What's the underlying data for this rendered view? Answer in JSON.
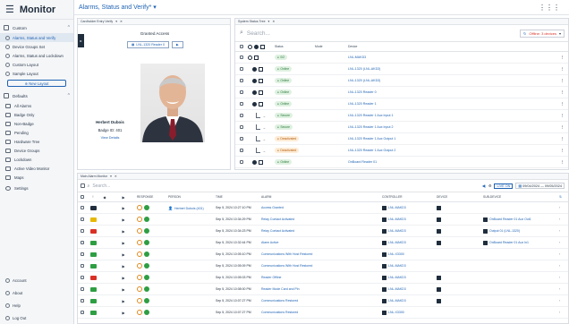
{
  "app": {
    "brand": "Monitor",
    "page_title": "Alarms, Status and Verify*"
  },
  "sidebar": {
    "custom_label": "Custom",
    "custom_items": [
      {
        "label": "Alarms, Status and Verify",
        "active": true
      },
      {
        "label": "Device Groups Set",
        "active": false
      },
      {
        "label": "Alarms, Status and Lockdown",
        "active": false
      },
      {
        "label": "Custom Layout",
        "active": false
      },
      {
        "label": "Sample Layout",
        "active": false
      }
    ],
    "new_layout_label": "New Layout",
    "defaults_label": "Defaults",
    "default_items": [
      {
        "label": "All Alarms"
      },
      {
        "label": "Badge Only"
      },
      {
        "label": "Non-Badge"
      },
      {
        "label": "Pending"
      },
      {
        "label": "Hardware Tree"
      },
      {
        "label": "Device Groups"
      },
      {
        "label": "Lockdown"
      },
      {
        "label": "Active Video Monitor"
      },
      {
        "label": "Maps"
      }
    ],
    "settings_label": "Settings",
    "bottom_items": [
      {
        "label": "Account"
      },
      {
        "label": "About"
      },
      {
        "label": "Help"
      },
      {
        "label": "Log Out"
      }
    ]
  },
  "card_panel": {
    "tab_label": "Cardholder Entry Verify",
    "granted": "Granted Access",
    "reader": "LNL-1320 Reader 0",
    "name": "Herbert Dubois",
    "badge": "Badge ID: 401",
    "view_details": "View Details"
  },
  "status_panel": {
    "tab_label": "System Status Tree",
    "search_placeholder": "Search...",
    "offline_label": "Offline: 3 devices",
    "headers": {
      "status": "Status",
      "mode": "Mode",
      "device": "Device"
    },
    "rows": [
      {
        "status": "0/2",
        "status_type": "online",
        "device": "LNL-MAKD3",
        "node": "root"
      },
      {
        "status": "Online",
        "status_type": "online",
        "device": "LNL-1320 (LNL-AKD3)",
        "node": "child"
      },
      {
        "status": "Online",
        "status_type": "online",
        "device": "LNL-1320 (LNL-AKD3)",
        "node": "child"
      },
      {
        "status": "Online",
        "status_type": "online",
        "device": "LNL-1320 Reader 0",
        "node": "child"
      },
      {
        "status": "Online",
        "status_type": "online",
        "device": "LNL-1320 Reader 1",
        "node": "child"
      },
      {
        "status": "Secure",
        "status_type": "secure",
        "device": "LNL-1320 Reader 1 Aux Input 1",
        "node": "leaf"
      },
      {
        "status": "Secure",
        "status_type": "secure",
        "device": "LNL-1320 Reader 1 Aux Input 2",
        "node": "leaf"
      },
      {
        "status": "Deactivated",
        "status_type": "deact",
        "device": "LNL-1320 Reader 1 Aux Output 1",
        "node": "leaf"
      },
      {
        "status": "Deactivated",
        "status_type": "deact",
        "device": "LNL-1320 Reader 1 Aux Output 2",
        "node": "leaf"
      },
      {
        "status": "Online",
        "status_type": "online",
        "device": "OnBoard Reader 01",
        "node": "child"
      }
    ]
  },
  "alarm_panel": {
    "tab_label": "Main Alarm Monitor",
    "search_placeholder": "Search...",
    "live_label": "LIVE ON",
    "date_range": "09/04/2024 — 09/05/2024",
    "headers": {
      "response": "RESPONSE",
      "person": "PERSON",
      "time": "TIME",
      "alarm": "ALARM",
      "controller": "CONTROLLER",
      "device": "DEVICE",
      "sub_device": "SUB-DEVICE"
    },
    "rows": [
      {
        "pri": "#1f2d3d",
        "person": "Herbert Dubois (401)",
        "time": "Sep 5, 2024 10:27:10 PM",
        "alarm": "Access Granted",
        "controller": "LNL-MAKD3",
        "device": true,
        "sub": ""
      },
      {
        "pri": "#e6b800",
        "person": "",
        "time": "Sep 5, 2024 10:34:29 PM",
        "alarm": "Relay Contact Activated",
        "controller": "LNL-MAKD3",
        "device": true,
        "sub": "OnBoard Reader 01 Aux Out1"
      },
      {
        "pri": "#d93025",
        "person": "",
        "time": "Sep 5, 2024 10:34:23 PM",
        "alarm": "Relay Contact Activated",
        "controller": "LNL-MAKD3",
        "device": true,
        "sub": "Output 01 (LNL-1320)"
      },
      {
        "pri": "#2e9e43",
        "person": "",
        "time": "Sep 5, 2024 10:32:44 PM",
        "alarm": "Alarm Active",
        "controller": "LNL-MAKD3",
        "device": true,
        "sub": "OnBoard Reader 01 Aux In1"
      },
      {
        "pri": "#2e9e43",
        "person": "",
        "time": "Sep 5, 2024 10:05:10 PM",
        "alarm": "Communications With Host Restored",
        "controller": "LNL-X3300",
        "device": false,
        "sub": ""
      },
      {
        "pri": "#2e9e43",
        "person": "",
        "time": "Sep 5, 2024 10:05:09 PM",
        "alarm": "Communications With Host Restored",
        "controller": "LNL-MAKD3",
        "device": false,
        "sub": ""
      },
      {
        "pri": "#d93025",
        "person": "",
        "time": "Sep 5, 2024 10:05:03 PM",
        "alarm": "Reader Offline",
        "controller": "LNL-MAKD3",
        "device": true,
        "sub": ""
      },
      {
        "pri": "#2e9e43",
        "person": "",
        "time": "Sep 5, 2024 10:08:00 PM",
        "alarm": "Reader Mode Card and Pin",
        "controller": "LNL-MAKD3",
        "device": true,
        "sub": ""
      },
      {
        "pri": "#2e9e43",
        "person": "",
        "time": "Sep 5, 2024 10:07:27 PM",
        "alarm": "Communications Restored",
        "controller": "LNL-MAKD3",
        "device": true,
        "sub": ""
      },
      {
        "pri": "#2e9e43",
        "person": "",
        "time": "Sep 5, 2024 10:07:27 PM",
        "alarm": "Communications Restored",
        "controller": "LNL-X3300",
        "device": false,
        "sub": ""
      }
    ]
  },
  "colors": {
    "accent": "#1e62b3",
    "dark": "#1f2d3d",
    "online": "#2e9e43",
    "alert": "#d93025"
  }
}
